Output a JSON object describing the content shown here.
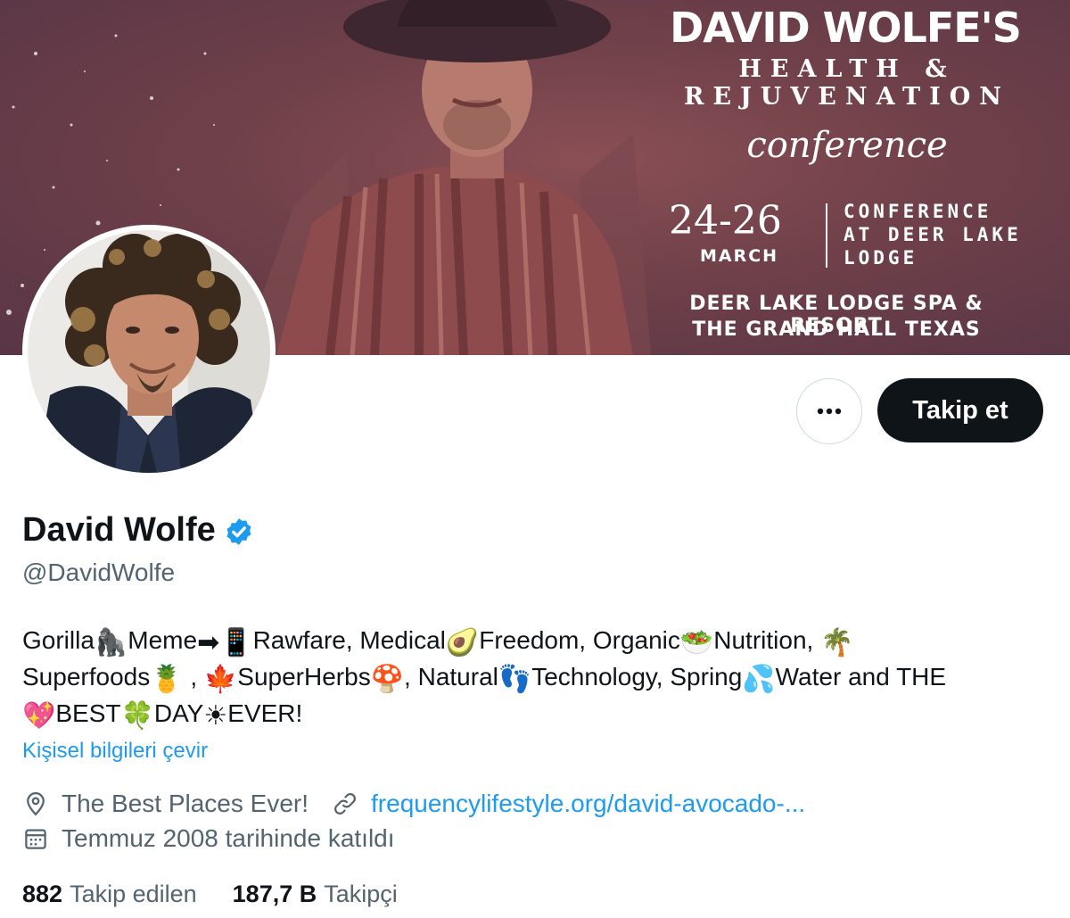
{
  "banner": {
    "title": "DAVID WOLFE'S",
    "line1": "HEALTH &",
    "line2": "REJUVENATION",
    "conference": "conference",
    "dates": "24-26",
    "month": "MARCH",
    "venue_line1": "CONFERENCE",
    "venue_line2": "AT DEER LAKE",
    "venue_line3": "LODGE",
    "bottom_line1": "DEER LAKE LODGE SPA & RESORT",
    "bottom_line2": "THE GRAND HALL TEXAS"
  },
  "actions": {
    "more_label": "•••",
    "follow_label": "Takip et"
  },
  "profile": {
    "display_name": "David Wolfe",
    "handle": "@DavidWolfe",
    "verified": true,
    "bio": {
      "w1": "Gorilla",
      "e1": "🦍",
      "w2": "Meme",
      "e2": "➡📱",
      "w3": "Rawfare, Medical",
      "e3": "🥑",
      "w4": "Freedom, Organic",
      "e4": "🥗",
      "w5": "Nutrition,",
      "e5": "🌴",
      "w6": "Superfoods",
      "e6": "🍍",
      "w7": ",",
      "e7": "🍁",
      "w8": "SuperHerbs",
      "e8": "🍄",
      "w9": ", Natural",
      "e9": "👣",
      "w10": "Technology, Spring",
      "e10": "💦",
      "w11": "Water and THE",
      "e11": "💖",
      "w12": "BEST",
      "e12": "🍀",
      "w13": "DAY",
      "e13": "☀",
      "w14": "EVER!"
    },
    "translate_label": "Kişisel bilgileri çevir",
    "location": "The Best Places Ever!",
    "website": "frequencylifestyle.org/david-avocado-...",
    "joined": "Temmuz 2008 tarihinde katıldı"
  },
  "stats": {
    "following_count": "882",
    "following_label": "Takip edilen",
    "followers_count": "187,7 B",
    "followers_label": "Takipçi"
  },
  "icons": {
    "location": "location-pin-icon",
    "link": "link-icon",
    "calendar": "calendar-icon",
    "verified": "verified-badge-icon",
    "more": "more-horizontal-icon"
  },
  "colors": {
    "accent": "#1d9bf0",
    "text_primary": "#0f1419",
    "text_secondary": "#536471",
    "follow_button_bg": "#0f1419",
    "banner_bg": "#6f4049"
  }
}
